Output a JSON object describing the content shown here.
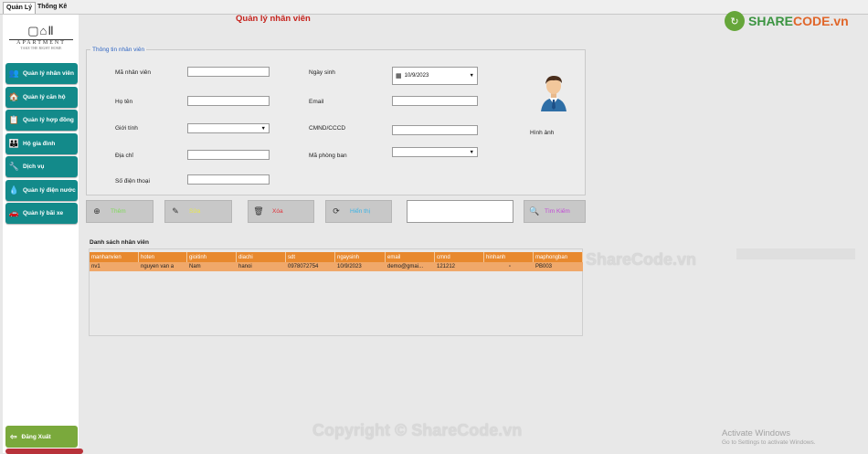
{
  "window_tabs": [
    "Quản Lý",
    "Thống Kê"
  ],
  "logo": {
    "mark": "▢⌂Ⅱ",
    "word": "APARTMENT",
    "sub": "TAKE THE RIGHT HOME"
  },
  "sidebar": {
    "items": [
      {
        "label": "Quản lý nhân viên",
        "icon": "staff-icon"
      },
      {
        "label": "Quản lý căn hộ",
        "icon": "house-icon"
      },
      {
        "label": "Quản lý hợp đồng",
        "icon": "contract-icon"
      },
      {
        "label": "Hộ gia đình",
        "icon": "family-icon"
      },
      {
        "label": "Dịch vụ",
        "icon": "service-icon"
      },
      {
        "label": "Quản lý điện nước",
        "icon": "utility-icon"
      },
      {
        "label": "Quản lý bãi xe",
        "icon": "parking-icon"
      }
    ],
    "logout_label": "Đăng Xuất"
  },
  "page": {
    "title": "Quản lý nhân viên",
    "group_title": "Thông tin nhân viên",
    "labels": {
      "ma_nv": "Mã nhân viên",
      "ho_ten": "Họ tên",
      "gioi_tinh": "Giới tính",
      "dia_chi": "Địa chỉ",
      "sdt": "Số điện thoại",
      "ngay_sinh": "Ngày sinh",
      "email": "Email",
      "cmnd": "CMND/CCCD",
      "ma_phong_ban": "Mã phòng ban",
      "hinh_anh": "Hình ảnh"
    },
    "date_value": "10/9/2023",
    "buttons": {
      "them": "Thêm",
      "sua": "Sửa",
      "xoa": "Xóa",
      "hien_thi": "Hiển thị",
      "tim_kiem": "Tìm Kiếm"
    },
    "list_title": "Danh sách nhân viên"
  },
  "table": {
    "headers": [
      "manhanvien",
      "hoten",
      "gioitinh",
      "diachi",
      "sdt",
      "ngaysinh",
      "email",
      "cmnd",
      "hinhanh",
      "maphongban"
    ],
    "rows": [
      [
        "nv1",
        "nguyen van a",
        "Nam",
        "hanoi",
        "0978072754",
        "10/9/2023",
        "demo@gmai...",
        "121212",
        "▫",
        "PB003"
      ]
    ]
  },
  "watermarks": {
    "brand_a": "SHARE",
    "brand_b": "CODE.vn",
    "mid": "ShareCode.vn",
    "bottom": "Copyright © ShareCode.vn"
  },
  "os_notice": {
    "line1": "Activate Windows",
    "line2": "Go to Settings to activate Windows."
  },
  "colors": {
    "nav_teal": "#138a8a",
    "header_orange": "#e8892e",
    "row_orange": "#f0a86a",
    "title_red": "#c6241e",
    "logout_green": "#7aa93c"
  }
}
